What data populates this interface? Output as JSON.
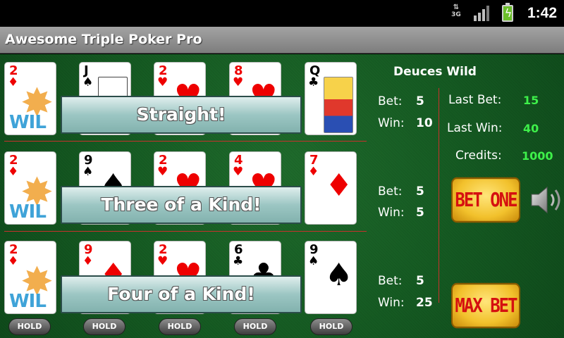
{
  "status_bar": {
    "network": "3G",
    "time": "1:42",
    "icons": [
      "data-arrows-icon",
      "signal-icon",
      "battery-charging-icon"
    ]
  },
  "app": {
    "title": "Awesome Triple Poker Pro"
  },
  "game": {
    "name": "Deuces Wild",
    "hands": [
      {
        "cards": [
          {
            "rank": "2",
            "suit": "♦",
            "color": "red",
            "wild": true
          },
          {
            "rank": "J",
            "suit": "♠",
            "color": "black",
            "face": "jack"
          },
          {
            "rank": "2",
            "suit": "♥",
            "color": "red"
          },
          {
            "rank": "8",
            "suit": "♥",
            "color": "red"
          },
          {
            "rank": "Q",
            "suit": "♣",
            "color": "black",
            "face": "queen"
          }
        ],
        "result": "Straight!",
        "bet_label": "Bet:",
        "bet": "5",
        "win_label": "Win:",
        "win": "10"
      },
      {
        "cards": [
          {
            "rank": "2",
            "suit": "♦",
            "color": "red",
            "wild": true
          },
          {
            "rank": "9",
            "suit": "♠",
            "color": "black"
          },
          {
            "rank": "2",
            "suit": "♥",
            "color": "red"
          },
          {
            "rank": "4",
            "suit": "♥",
            "color": "red"
          },
          {
            "rank": "7",
            "suit": "♦",
            "color": "red"
          }
        ],
        "result": "Three of a Kind!",
        "bet_label": "Bet:",
        "bet": "5",
        "win_label": "Win:",
        "win": "5"
      },
      {
        "cards": [
          {
            "rank": "2",
            "suit": "♦",
            "color": "red",
            "wild": true
          },
          {
            "rank": "9",
            "suit": "♦",
            "color": "red"
          },
          {
            "rank": "2",
            "suit": "♥",
            "color": "red"
          },
          {
            "rank": "6",
            "suit": "♣",
            "color": "black"
          },
          {
            "rank": "9",
            "suit": "♠",
            "color": "black"
          }
        ],
        "result": "Four of a Kind!",
        "bet_label": "Bet:",
        "bet": "5",
        "win_label": "Win:",
        "win": "25"
      }
    ],
    "wild_text": "WIL",
    "summary": {
      "last_bet_label": "Last Bet:",
      "last_bet": "15",
      "last_win_label": "Last Win:",
      "last_win": "40",
      "credits_label": "Credits:",
      "credits": "1000"
    },
    "buttons": {
      "bet_one": "BET ONE",
      "max_bet": "MAX BET",
      "hold": "HOLD"
    },
    "colors": {
      "felt": "#155a22",
      "divider": "#c8312c",
      "value_green": "#3ef04a",
      "banner": "#9cc6c3",
      "button_gold": "#f2c12c",
      "button_text": "#d51010"
    }
  }
}
